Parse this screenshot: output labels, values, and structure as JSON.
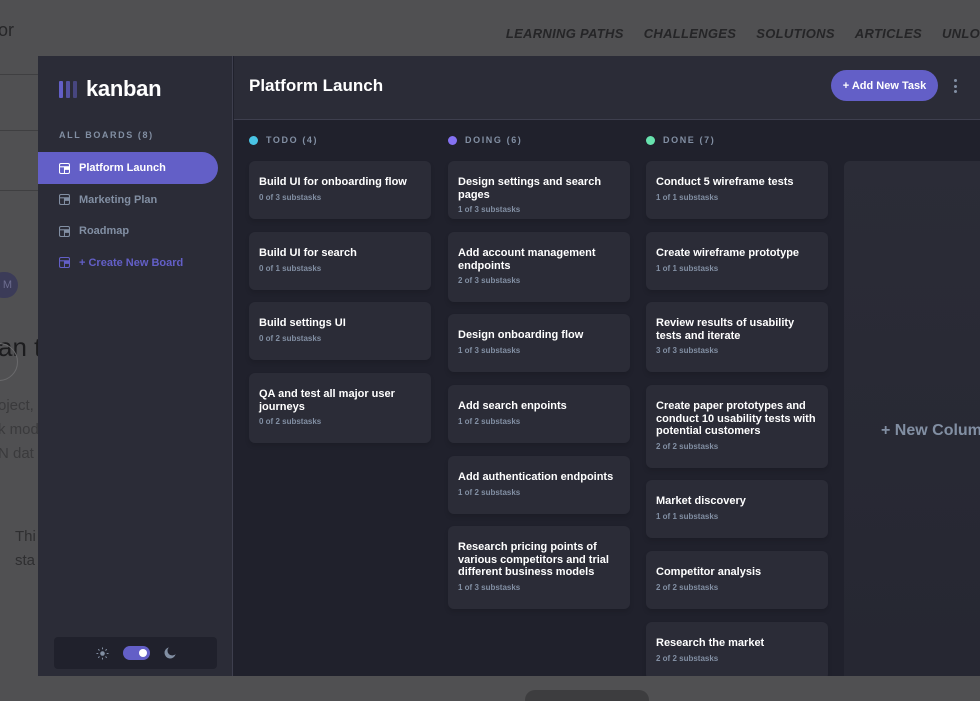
{
  "background_site": {
    "logo_fragment": "or",
    "nav": [
      "LEARNING PATHS",
      "CHALLENGES",
      "SOLUTIONS",
      "ARTICLES",
      "UNLO"
    ],
    "tag_fragment": "M",
    "heading_fragment": "an t",
    "para_lines": [
      "oject,",
      "k mod",
      "N dat"
    ],
    "para2_lines": [
      "Thi",
      "sta"
    ]
  },
  "app": {
    "logo": "kanban",
    "boards_heading": "ALL BOARDS (8)",
    "boards": [
      "Platform Launch",
      "Marketing Plan",
      "Roadmap"
    ],
    "create_board": "+ Create New Board",
    "board_title": "Platform Launch",
    "add_task_label": "+ Add New Task",
    "new_column_label": "+ New Column",
    "columns": [
      {
        "name": "TODO (4)",
        "color": "#49c4e5",
        "tasks": [
          {
            "title": "Build UI for onboarding flow",
            "sub": "0 of 3 substasks"
          },
          {
            "title": "Build UI for search",
            "sub": "0 of 1 substasks"
          },
          {
            "title": "Build settings UI",
            "sub": "0 of 2 substasks"
          },
          {
            "title": "QA and test all major user journeys",
            "sub": "0 of 2 substasks"
          }
        ]
      },
      {
        "name": "DOING (6)",
        "color": "#8471f2",
        "tasks": [
          {
            "title": "Design settings and search pages",
            "sub": "1 of 3 substasks"
          },
          {
            "title": "Add account management endpoints",
            "sub": "2 of 3 substasks"
          },
          {
            "title": "Design onboarding flow",
            "sub": "1 of 3 substasks"
          },
          {
            "title": "Add search enpoints",
            "sub": "1 of 2 substasks"
          },
          {
            "title": "Add authentication endpoints",
            "sub": "1 of 2 substasks"
          },
          {
            "title": "Research pricing points of various competitors and trial different business models",
            "sub": "1 of 3 substasks"
          }
        ]
      },
      {
        "name": "DONE (7)",
        "color": "#67e2ae",
        "tasks": [
          {
            "title": "Conduct 5 wireframe tests",
            "sub": "1 of 1 substasks"
          },
          {
            "title": "Create wireframe prototype",
            "sub": "1 of 1 substasks"
          },
          {
            "title": "Review results of usability tests and iterate",
            "sub": "3 of 3 substasks"
          },
          {
            "title": "Create paper prototypes and conduct 10 usability tests with potential customers",
            "sub": "2 of 2 substasks"
          },
          {
            "title": "Market discovery",
            "sub": "1 of 1 substasks"
          },
          {
            "title": "Competitor analysis",
            "sub": "2 of 2 substasks"
          },
          {
            "title": "Research the market",
            "sub": "2 of 2 substasks"
          }
        ]
      }
    ]
  }
}
